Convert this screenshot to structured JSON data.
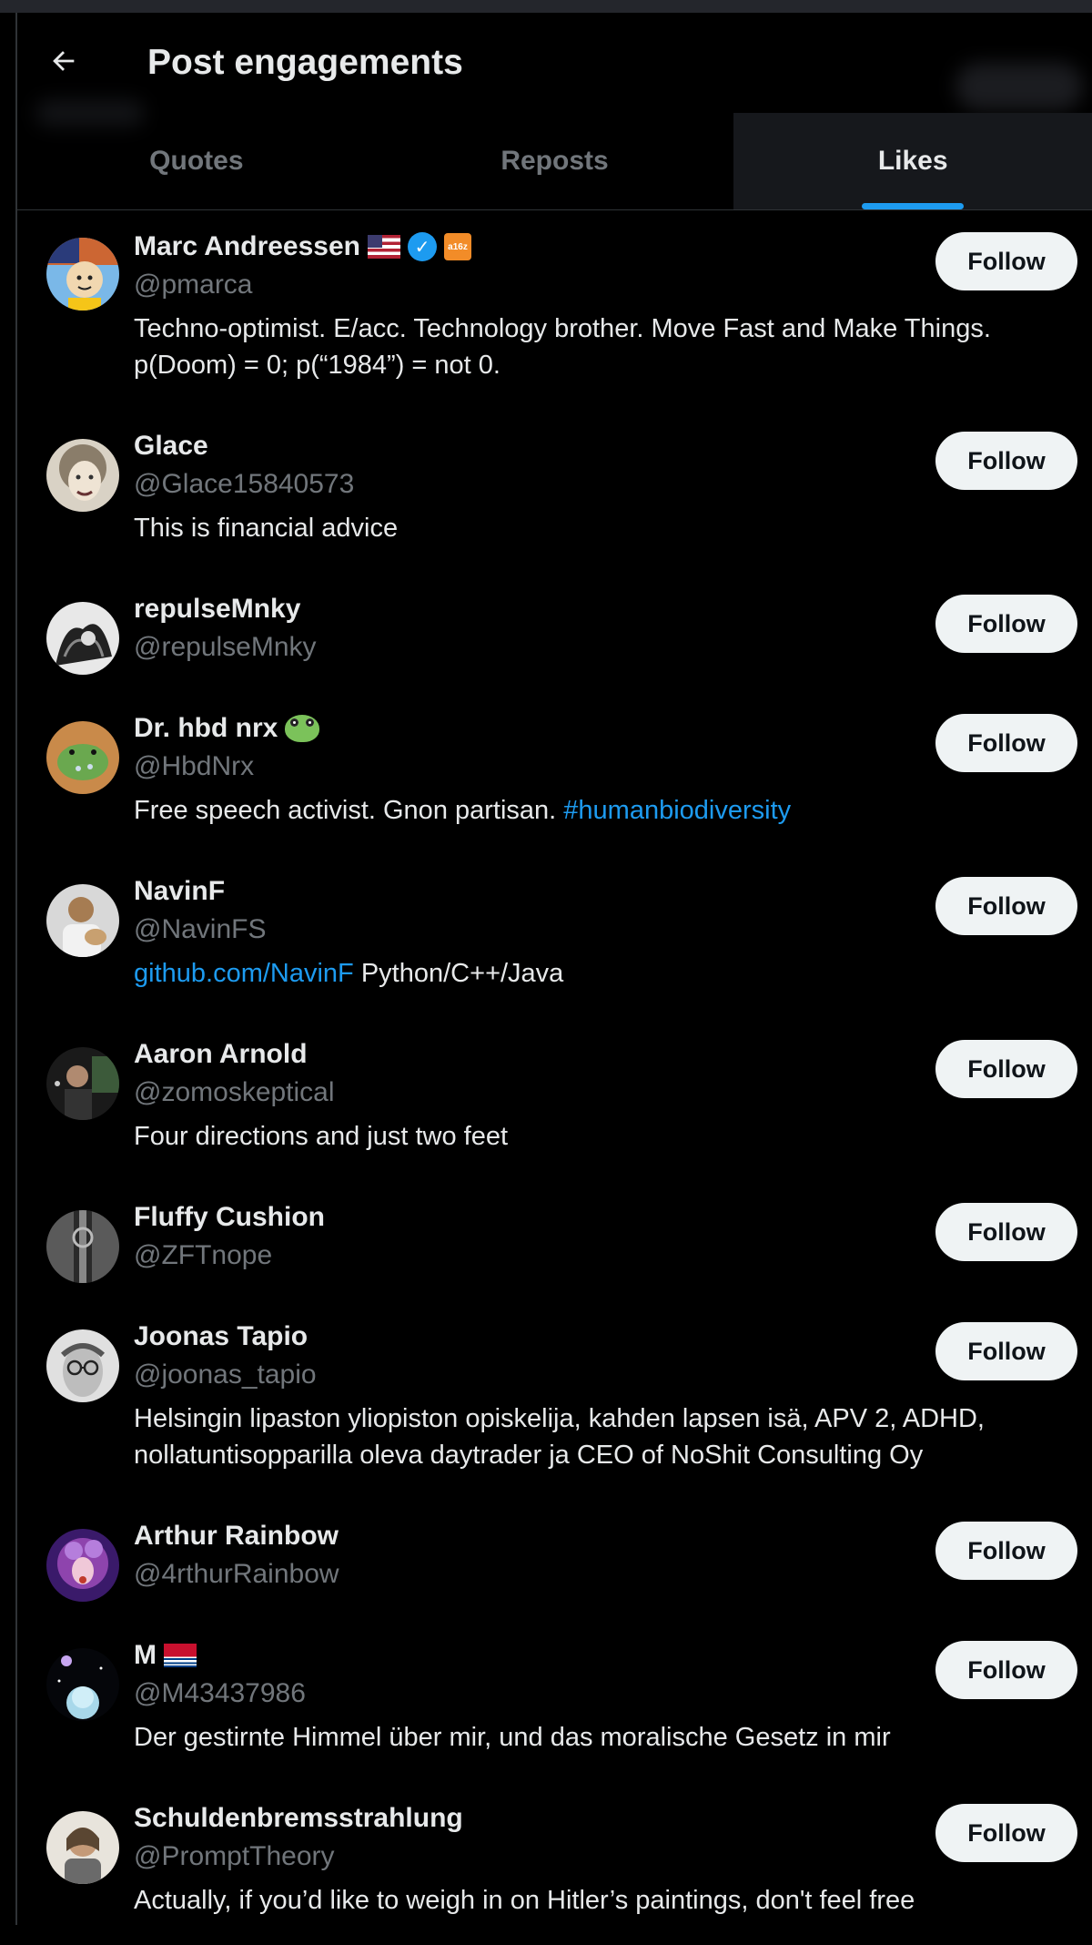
{
  "header": {
    "title": "Post engagements",
    "back_icon": "arrow-left-icon"
  },
  "tabs": [
    {
      "label": "Quotes",
      "active": false
    },
    {
      "label": "Reposts",
      "active": false
    },
    {
      "label": "Likes",
      "active": true
    }
  ],
  "colors": {
    "background": "#000000",
    "accent": "#1d9bf0",
    "text": "#e7e9ea",
    "muted": "#71767b",
    "follow_bg": "#eff3f4"
  },
  "follow_label": "Follow",
  "users": [
    {
      "name": "Marc Andreessen",
      "handle": "@pmarca",
      "badges": [
        "us-flag",
        "verified-check",
        "a16z-logo"
      ],
      "a16z_text": "a16z",
      "verified_mark": "✓",
      "bio": "Techno-optimist. E/acc. Technology brother. Move Fast and Make Things. p(Doom) = 0; p(“1984”) = not 0."
    },
    {
      "name": "Glace",
      "handle": "@Glace15840573",
      "badges": [],
      "bio": "This is financial advice"
    },
    {
      "name": "repulseMnky",
      "handle": "@repulseMnky",
      "badges": [],
      "bio": ""
    },
    {
      "name": "Dr. hbd nrx",
      "handle": "@HbdNrx",
      "badges": [
        "frog-emoji"
      ],
      "bio": "Free speech activist. Gnon partisan.",
      "bio_link": "#humanbiodiversity"
    },
    {
      "name": "NavinF",
      "handle": "@NavinFS",
      "badges": [],
      "bio_link": "github.com/NavinF",
      "bio": "Python/C++/Java"
    },
    {
      "name": "Aaron Arnold",
      "handle": "@zomoskeptical",
      "badges": [],
      "bio": "Four directions and just two feet"
    },
    {
      "name": "Fluffy Cushion",
      "handle": "@ZFTnope",
      "badges": [],
      "bio": ""
    },
    {
      "name": "Joonas Tapio",
      "handle": "@joonas_tapio",
      "badges": [],
      "bio": "Helsingin lipaston yliopiston opiskelija, kahden lapsen isä, APV 2, ADHD, nollatuntisopparilla oleva daytrader ja CEO of NoShit Consulting Oy"
    },
    {
      "name": "Arthur Rainbow",
      "handle": "@4rthurRainbow",
      "badges": [],
      "bio": ""
    },
    {
      "name": "M",
      "handle": "@M43437986",
      "badges": [
        "kiribati-flag"
      ],
      "bio": "Der gestirnte Himmel über mir, und das moralische Gesetz in mir"
    },
    {
      "name": "Schuldenbremsstrahlung",
      "handle": "@PromptTheory",
      "badges": [],
      "bio": "Actually, if you’d like to weigh in on Hitler’s paintings, don't feel free"
    }
  ]
}
